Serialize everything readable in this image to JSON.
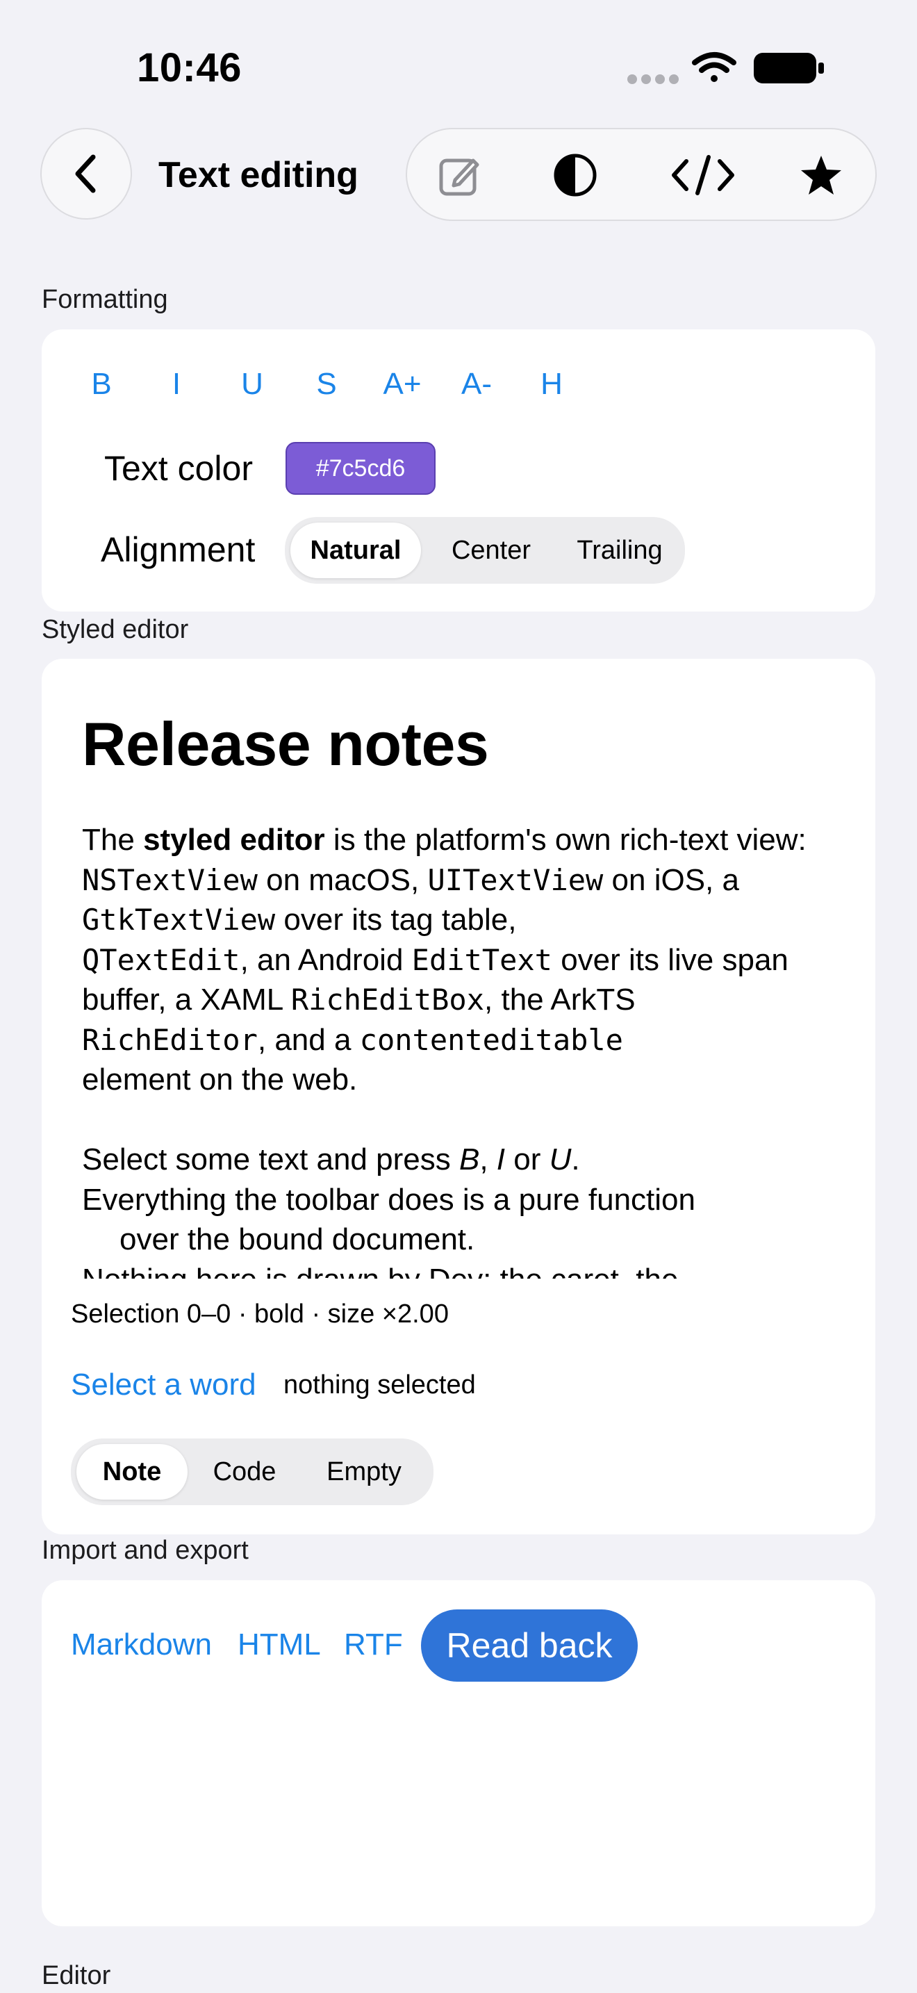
{
  "status_bar": {
    "time": "10:46"
  },
  "nav": {
    "title": "Text editing",
    "toolbar_icons": [
      "compose-icon",
      "contrast-icon",
      "code-icon",
      "star-icon"
    ]
  },
  "sections": {
    "formatting": "Formatting",
    "styled_editor": "Styled editor",
    "import_export": "Import and export",
    "editor": "Editor"
  },
  "formatting": {
    "buttons": [
      "B",
      "I",
      "U",
      "S",
      "A+",
      "A-",
      "H"
    ],
    "text_color_label": "Text color",
    "text_color_value": "#7c5cd6",
    "alignment_label": "Alignment",
    "alignment_options": [
      "Natural",
      "Center",
      "Trailing"
    ],
    "alignment_selected": "Natural"
  },
  "document": {
    "heading": "Release notes",
    "p1": {
      "the": "The",
      "styled_editor": "styled editor",
      "is_platform": "is the platform's own rich-text view:",
      "nstextview": "NSTextView",
      "on_macos": "on macOS,",
      "uitextview": "UITextView",
      "on_ios": "on iOS, a",
      "gtktextview": "GtkTextView",
      "over_tag": "over its tag table,",
      "qtextedit": "QTextEdit",
      "an_android": ", an Android",
      "edittext": "EditText",
      "over_live": "over its live span buffer, a XAML",
      "richeditbox": "RichEditBox",
      "the_arkts": ", the ArkTS",
      "richeditor": "RichEditor",
      "and_a": ", and a",
      "contenteditable": "contenteditable",
      "element_web": "element on the web."
    },
    "p2": {
      "select_some": "Select some text and press",
      "b": "B",
      "comma": ",",
      "i": "I",
      "or": "or",
      "u": "U",
      "period": "."
    },
    "p3_line1": "Everything the toolbar does is a pure function",
    "p3_line2": "over the bound document.",
    "p4_line1": "Nothing here is drawn by Dev: the caret, the"
  },
  "editor_footer": {
    "selection_status": "Selection 0–0 · bold · size ×2.00",
    "select_word": "Select a word",
    "nothing_selected": "nothing selected",
    "sample_options": [
      "Note",
      "Code",
      "Empty"
    ],
    "sample_selected": "Note"
  },
  "import_export": {
    "links": [
      "Markdown",
      "HTML",
      "RTF"
    ],
    "read_back": "Read back"
  },
  "colors": {
    "accent": "#1a84e8",
    "primary_button": "#2f74d8",
    "text_color_chip": "#7c5cd6",
    "background": "#f2f2f7"
  }
}
